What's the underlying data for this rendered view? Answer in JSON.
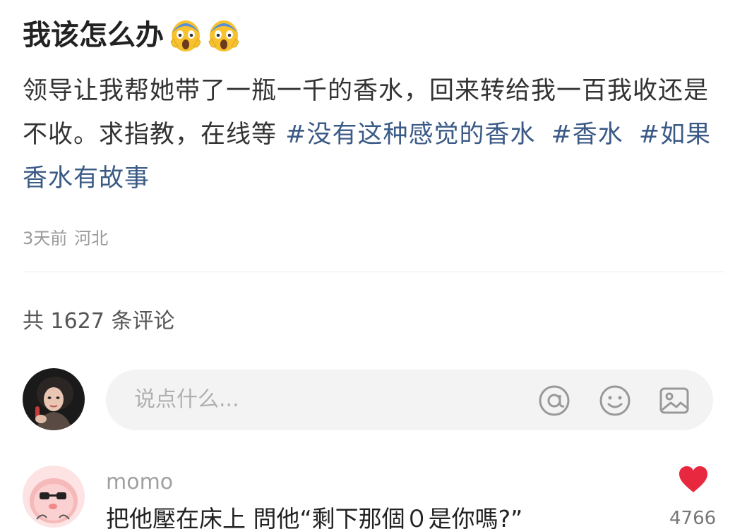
{
  "post": {
    "title": "我该怎么办",
    "title_emojis": [
      "scream-emoji",
      "scream-emoji"
    ],
    "body_text": "领导让我帮她带了一瓶一千的香水，回来转给我一百我收还是不收。求指教，在线等 ",
    "hashtags": [
      "#没有这种感觉的香水",
      "#香水",
      "#如果香水有故事"
    ],
    "meta": {
      "time": "3天前",
      "location": "河北"
    }
  },
  "comments_section": {
    "count_label": "共 1627 条评论",
    "input": {
      "placeholder": "说点什么..."
    },
    "icons": [
      "at-icon",
      "emoji-icon",
      "image-icon"
    ]
  },
  "comments": [
    {
      "username": "momo",
      "text": "把他壓在床上 問他“剩下那個０是你嗎?”",
      "likes": "4766"
    }
  ],
  "colors": {
    "hashtag": "#3b5a86",
    "like": "#e8283e",
    "input_bg": "#f3f3f3"
  }
}
